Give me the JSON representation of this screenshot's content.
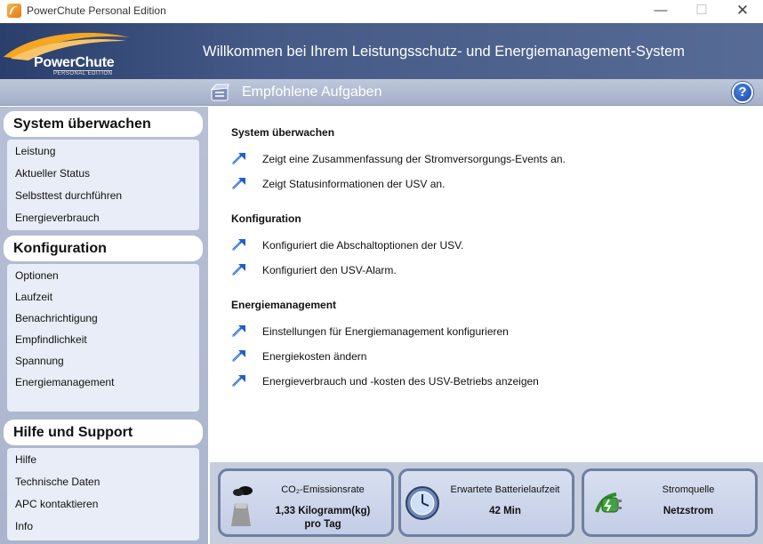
{
  "window": {
    "title": "PowerChute Personal Edition",
    "minimize": "—",
    "maximize": "☐",
    "close": "✕"
  },
  "header": {
    "logo_text": "PowerChute",
    "logo_sub": "PERSONAL EDITION",
    "title": "Willkommen bei Ihrem Leistungsschutz- und Energiemanagement-System"
  },
  "subbar": {
    "title": "Empfohlene Aufgaben",
    "help": "?"
  },
  "sidebar": {
    "sections": [
      {
        "title": "System überwachen",
        "items": [
          "Leistung",
          "Aktueller Status",
          "Selbsttest durchführen",
          "Energieverbrauch"
        ]
      },
      {
        "title": "Konfiguration",
        "items": [
          "Optionen",
          "Laufzeit",
          "Benachrichtigung",
          "Empfindlichkeit",
          "Spannung",
          "Energiemanagement"
        ]
      },
      {
        "title": "Hilfe und Support",
        "items": [
          "Hilfe",
          "Technische Daten",
          "APC kontaktieren",
          "Info"
        ]
      }
    ]
  },
  "main": {
    "groups": [
      {
        "title": "System überwachen",
        "tasks": [
          "Zeigt eine Zusammenfassung der Stromversorgungs-Events an.",
          "Zeigt Statusinformationen der USV an."
        ]
      },
      {
        "title": "Konfiguration",
        "tasks": [
          "Konfiguriert die Abschaltoptionen der USV.",
          "Konfiguriert den USV-Alarm."
        ]
      },
      {
        "title": "Energiemanagement",
        "tasks": [
          "Einstellungen für Energiemanagement konfigurieren",
          "Energiekosten ändern",
          "Energieverbrauch und -kosten des USV-Betriebs anzeigen"
        ]
      }
    ]
  },
  "status": {
    "co2": {
      "title": "CO₂-Emissionsrate",
      "value": "1,33 Kilogramm(kg)",
      "value2": "pro Tag"
    },
    "battery": {
      "title": "Erwartete Batterielaufzeit",
      "value": "42 Min"
    },
    "source": {
      "title": "Stromquelle",
      "value": "Netzstrom"
    }
  },
  "colors": {
    "header": "#455a86",
    "sidebar": "#aab4cc",
    "card_border": "#6f7ea2",
    "accent": "#2a6fd6"
  }
}
